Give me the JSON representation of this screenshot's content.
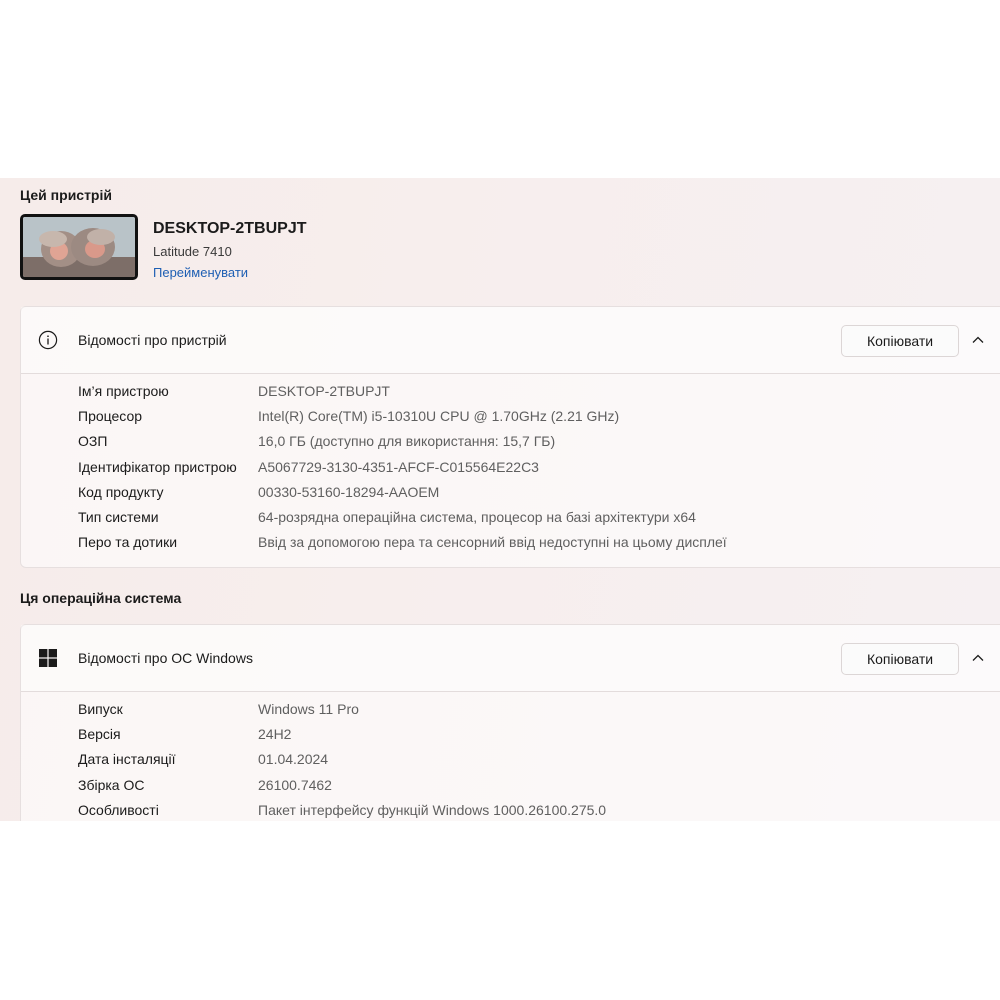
{
  "device": {
    "section_title": "Цей пристрій",
    "name": "DESKTOP-2TBUPJT",
    "model": "Latitude 7410",
    "rename_link": "Перейменувати"
  },
  "device_specs": {
    "title": "Відомості про пристрій",
    "icon": "info-icon",
    "copy_label": "Копіювати",
    "rows": [
      {
        "label": "Ім’я пристрою",
        "value": "DESKTOP-2TBUPJT"
      },
      {
        "label": "Процесор",
        "value": "Intel(R) Core(TM) i5-10310U CPU @ 1.70GHz (2.21 GHz)"
      },
      {
        "label": "ОЗП",
        "value": "16,0 ГБ (доступно для використання: 15,7 ГБ)"
      },
      {
        "label": "Ідентифікатор пристрою",
        "value": "A5067729-3130-4351-AFCF-C015564E22C3"
      },
      {
        "label": "Код продукту",
        "value": "00330-53160-18294-AAOEM"
      },
      {
        "label": "Тип системи",
        "value": "64-розрядна операційна система, процесор на базі архітектури x64"
      },
      {
        "label": "Перо та дотики",
        "value": "Ввід за допомогою пера та сенсорний ввід недоступні на цьому дисплеї"
      }
    ]
  },
  "os": {
    "section_title": "Ця операційна система",
    "title": "Відомості про ОС Windows",
    "icon": "windows-logo-icon",
    "copy_label": "Копіювати",
    "rows": [
      {
        "label": "Випуск",
        "value": "Windows 11 Pro"
      },
      {
        "label": "Версія",
        "value": "24H2"
      },
      {
        "label": "Дата інсталяції",
        "value": "01.04.2024"
      },
      {
        "label": "Збірка ОС",
        "value": "26100.7462"
      },
      {
        "label": "Особливості",
        "value": "Пакет інтерфейсу функцій Windows 1000.26100.275.0"
      }
    ]
  }
}
